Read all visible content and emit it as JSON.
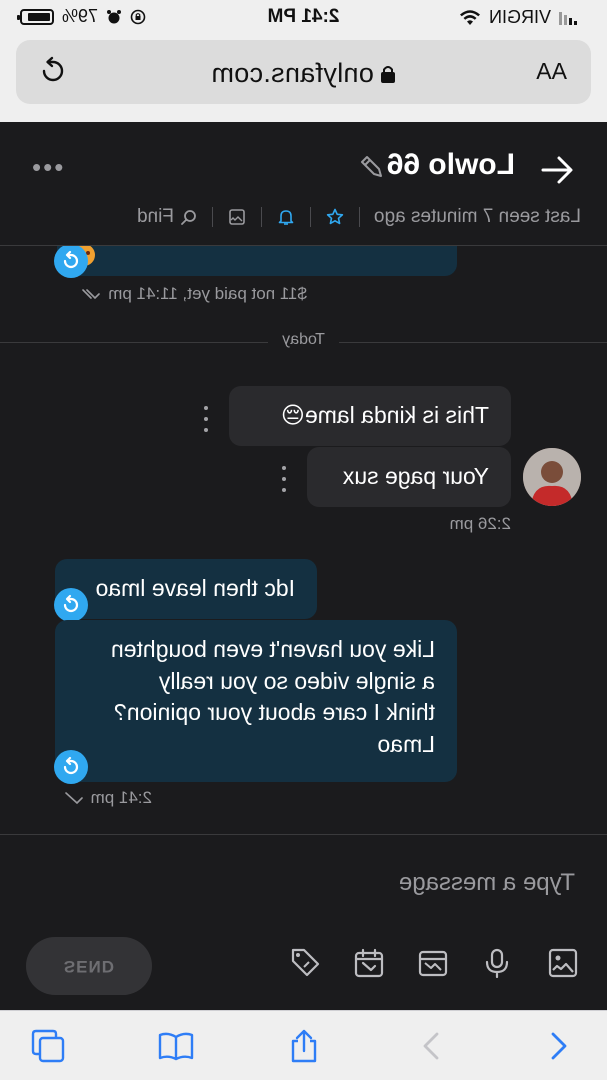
{
  "status_bar": {
    "carrier": "VIRGIN",
    "time": "2:41 PM",
    "battery": "79%"
  },
  "browser": {
    "url": "onlyfans.com",
    "text_size_label": "AA"
  },
  "chat": {
    "contact_name": "Lowlo 66",
    "last_seen": "Last seen 7 minutes ago",
    "find_label": "Find"
  },
  "messages": {
    "tip_status": "$11 not paid yet, 11:41 pm",
    "day_divider": "Today",
    "outgoing": [
      {
        "text": "This is kinda lame😔"
      },
      {
        "text": "Your page sux"
      }
    ],
    "outgoing_time": "2:26 pm",
    "incoming": [
      {
        "lines": [
          "Idc then leave lmao"
        ]
      },
      {
        "lines": [
          "Like you haven't even boughten",
          "a single video so you really",
          "think I care about your opinion?",
          "Lmao"
        ]
      }
    ],
    "incoming_time": "2:41 pm"
  },
  "composer": {
    "placeholder": "Type a message",
    "send_label": "SEND"
  },
  "colors": {
    "accent": "#30a8f0",
    "incoming_bubble": "#143041",
    "outgoing_bubble": "#2a2a2d",
    "background": "#1b1b1d"
  }
}
